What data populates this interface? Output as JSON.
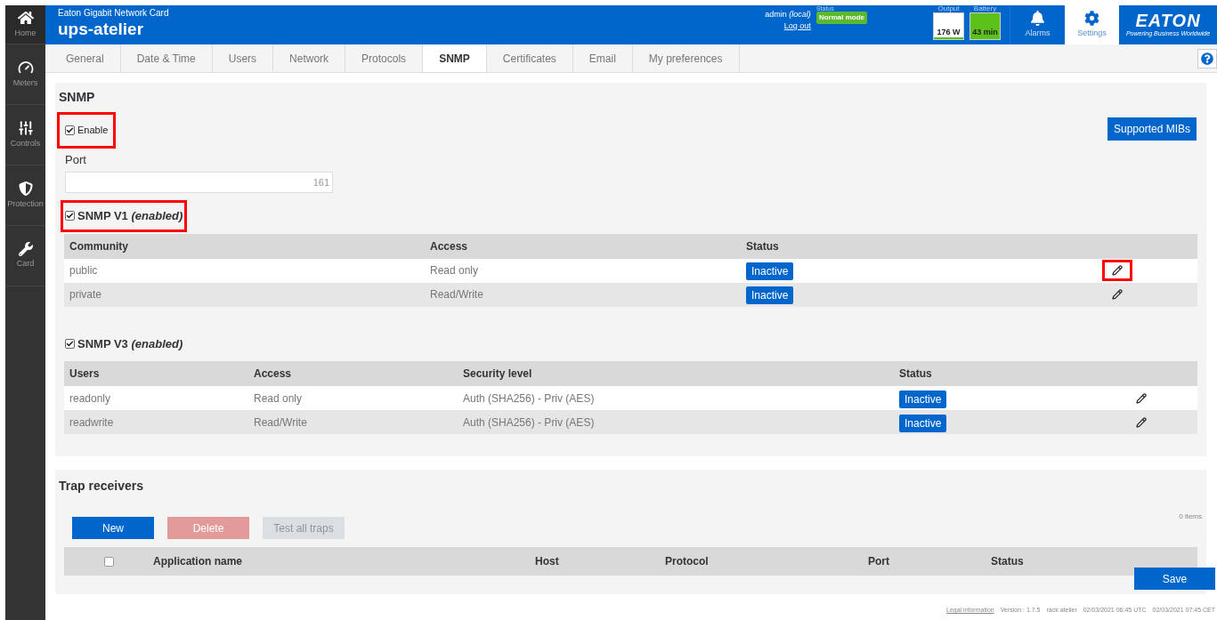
{
  "sidebar": {
    "items": [
      {
        "label": "Home"
      },
      {
        "label": "Meters"
      },
      {
        "label": "Controls"
      },
      {
        "label": "Protection"
      },
      {
        "label": "Card"
      }
    ]
  },
  "header": {
    "subtitle": "Eaton Gigabit Network Card",
    "title": "ups-atelier",
    "user": "admin",
    "user_scope": "(local)",
    "logout": "Log out",
    "status_label": "Status",
    "status": "Normal mode",
    "meters": [
      {
        "label": "Output",
        "reading": "176 W"
      },
      {
        "label": "Battery",
        "reading": "43 min"
      }
    ],
    "nav": [
      {
        "label": "Alarms",
        "selected": false
      },
      {
        "label": "Settings",
        "selected": true
      }
    ],
    "logo": {
      "name": "EATON",
      "tagline": "Powering Business Worldwide"
    }
  },
  "tabs": [
    {
      "label": "General",
      "selected": false
    },
    {
      "label": "Date & Time",
      "selected": false
    },
    {
      "label": "Users",
      "selected": false
    },
    {
      "label": "Network",
      "selected": false
    },
    {
      "label": "Protocols",
      "selected": false
    },
    {
      "label": "SNMP",
      "selected": true
    },
    {
      "label": "Certificates",
      "selected": false
    },
    {
      "label": "Email",
      "selected": false
    },
    {
      "label": "My preferences",
      "selected": false
    }
  ],
  "snmp": {
    "title": "SNMP",
    "enable": {
      "label": "Enable",
      "checked": true,
      "highlighted": true
    },
    "mibs_button": "Supported MIBs",
    "port": {
      "label": "Port",
      "value": "161"
    },
    "v1": {
      "label": "SNMP V1",
      "note": "(enabled)",
      "checked": true,
      "highlighted": true,
      "columns": [
        "Community",
        "Access",
        "Status"
      ],
      "rows": [
        {
          "cells": [
            "public",
            "Read only"
          ],
          "status": "Inactive",
          "edit_highlighted": true
        },
        {
          "cells": [
            "private",
            "Read/Write"
          ],
          "status": "Inactive",
          "edit_highlighted": false
        }
      ]
    },
    "v3": {
      "label": "SNMP V3",
      "note": "(enabled)",
      "checked": true,
      "highlighted": false,
      "columns": [
        "Users",
        "Access",
        "Security level",
        "Status"
      ],
      "rows": [
        {
          "cells": [
            "readonly",
            "Read only",
            "Auth (SHA256) - Priv (AES)"
          ],
          "status": "Inactive",
          "edit_highlighted": false
        },
        {
          "cells": [
            "readwrite",
            "Read/Write",
            "Auth (SHA256) - Priv (AES)"
          ],
          "status": "Inactive",
          "edit_highlighted": false
        }
      ]
    }
  },
  "traps": {
    "title": "Trap receivers",
    "buttons": [
      {
        "label": "New",
        "kind": "primary",
        "disabled": false
      },
      {
        "label": "Delete",
        "kind": "danger",
        "disabled": true
      },
      {
        "label": "Test all traps",
        "kind": "secondary",
        "disabled": true
      }
    ],
    "count": "0 items",
    "select_all": false,
    "columns": [
      "Application name",
      "Host",
      "Protocol",
      "Port",
      "Status"
    ]
  },
  "save_button": "Save",
  "footer": {
    "legal": "Legal information",
    "version": "Version : 1.7.5",
    "location": "rack atelier",
    "utc": "02/03/2021 06:45 UTC",
    "local": "02/03/2021 07:45 CET"
  }
}
